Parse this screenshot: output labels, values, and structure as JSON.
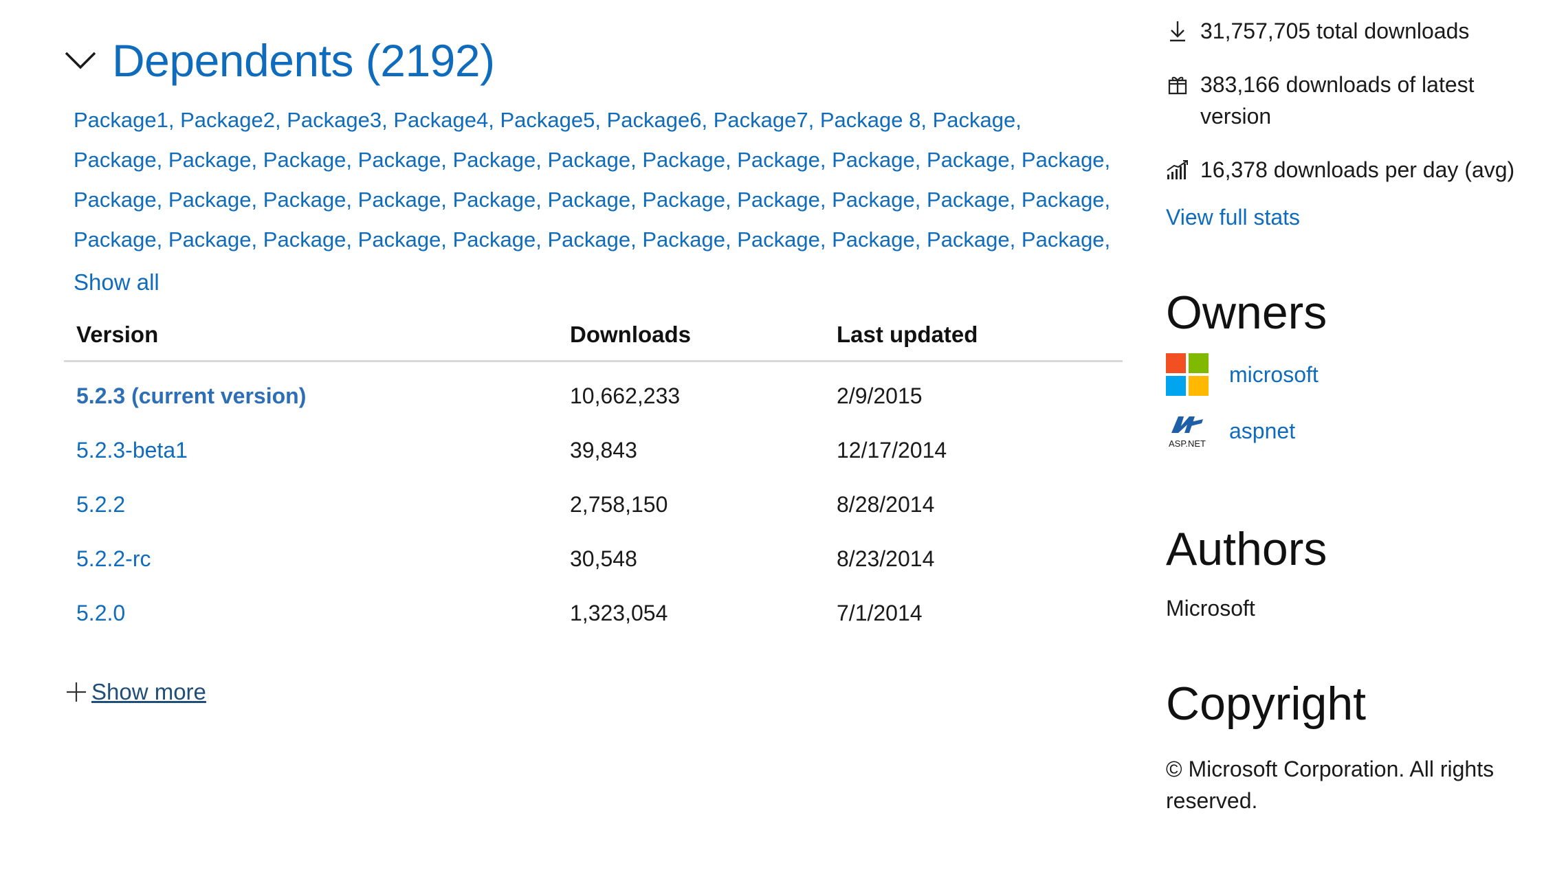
{
  "dependents": {
    "title": "Dependents (2192)",
    "lines": [
      [
        "Package1,",
        "Package2,",
        "Package3,",
        "Package4,",
        "Package5,",
        "Package6,",
        "Package7,",
        "Package 8,",
        "Package,"
      ],
      [
        "Package,",
        "Package,",
        "Package,",
        "Package,",
        "Package,",
        "Package,",
        "Package,",
        "Package,",
        "Package,",
        "Package,",
        "Package,"
      ],
      [
        "Package,",
        "Package,",
        "Package,",
        "Package,",
        "Package,",
        "Package,",
        "Package,",
        "Package,",
        "Package,",
        "Package,",
        "Package,"
      ],
      [
        "Package,",
        "Package,",
        "Package,",
        "Package,",
        "Package,",
        "Package,",
        "Package,",
        "Package,",
        "Package,",
        "Package,",
        "Package,"
      ]
    ],
    "show_all": "Show all"
  },
  "versions": {
    "headers": [
      "Version",
      "Downloads",
      "Last updated"
    ],
    "rows": [
      {
        "version": "5.2.3 (current version)",
        "downloads": "10,662,233",
        "updated": "2/9/2015",
        "current": true
      },
      {
        "version": "5.2.3-beta1",
        "downloads": "39,843",
        "updated": "12/17/2014",
        "current": false
      },
      {
        "version": "5.2.2",
        "downloads": "2,758,150",
        "updated": "8/28/2014",
        "current": false
      },
      {
        "version": "5.2.2-rc",
        "downloads": "30,548",
        "updated": "8/23/2014",
        "current": false
      },
      {
        "version": "5.2.0",
        "downloads": "1,323,054",
        "updated": "7/1/2014",
        "current": false
      }
    ],
    "show_more": "Show more"
  },
  "stats": {
    "total": "31,757,705 total downloads",
    "latest": "383,166 downloads of latest version",
    "per_day": "16,378 downloads per day (avg)",
    "view_full": "View full stats"
  },
  "owners": {
    "heading": "Owners",
    "items": [
      {
        "name": "microsoft",
        "logo": "microsoft-logo"
      },
      {
        "name": "aspnet",
        "logo": "aspnet-logo",
        "logo_text": "ASP.NET"
      }
    ]
  },
  "authors": {
    "heading": "Authors",
    "value": "Microsoft"
  },
  "copyright": {
    "heading": "Copyright",
    "value": "© Microsoft Corporation. All rights reserved."
  },
  "colors": {
    "link": "#0f6cbd",
    "current_version": "#2d6fb6",
    "ms_red": "#f25022",
    "ms_green": "#7fba00",
    "ms_blue": "#00a4ef",
    "ms_yellow": "#ffb900",
    "aspnet_blue": "#1f5fa8"
  }
}
